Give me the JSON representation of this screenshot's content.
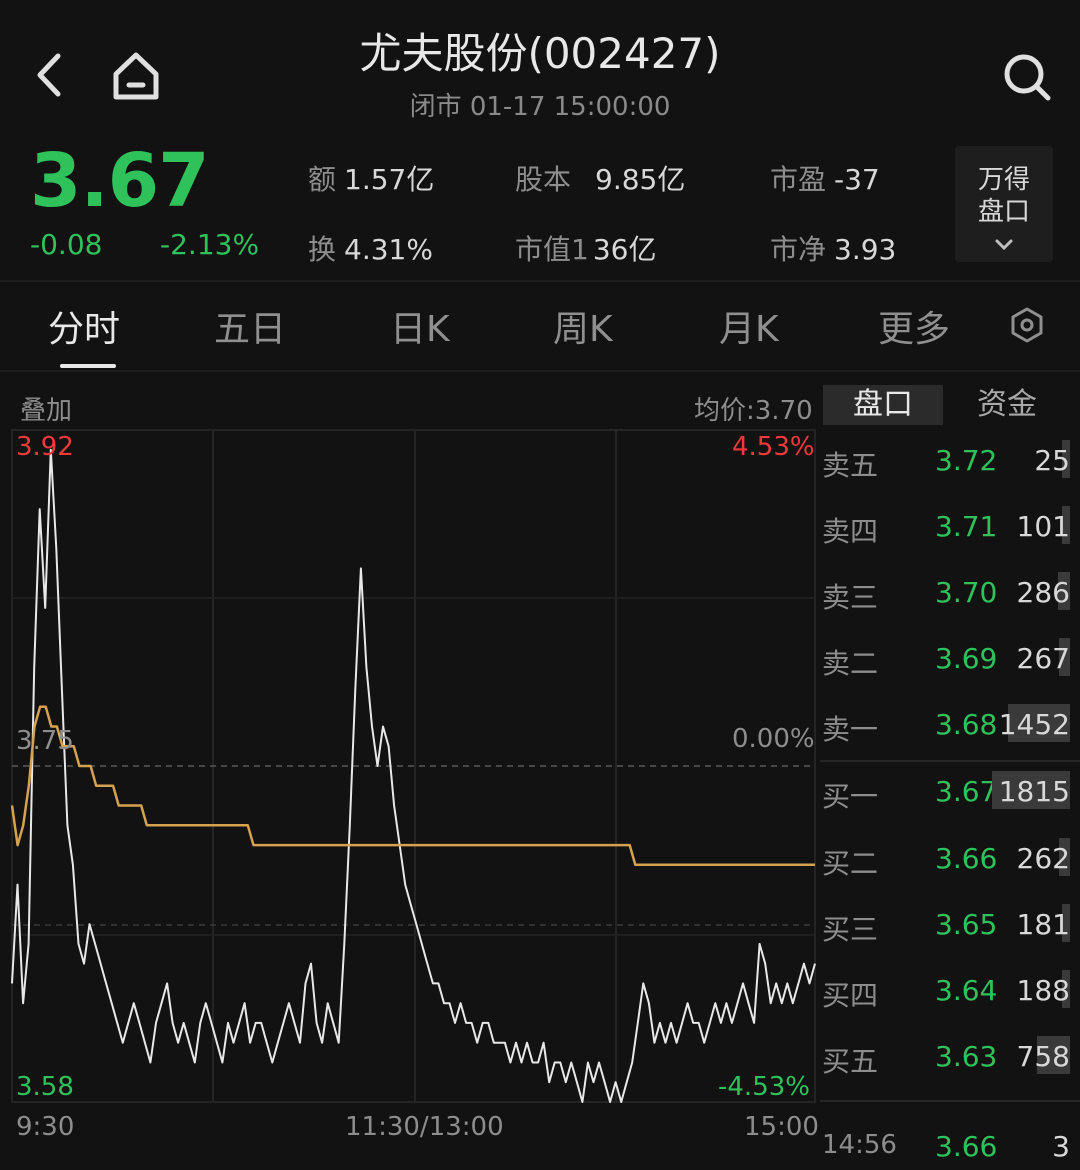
{
  "header": {
    "title": "尤夫股份(002427)",
    "subtitle": "闭市  01-17 15:00:00"
  },
  "quote": {
    "price": "3.67",
    "change": "-0.08",
    "change_pct": "-2.13%",
    "stats": [
      {
        "label": "额",
        "value": "1.57亿"
      },
      {
        "label": "股本",
        "value": "9.85亿"
      },
      {
        "label": "市盈",
        "value": "-37"
      },
      {
        "label": "换",
        "value": "4.31%"
      },
      {
        "label": "市值1",
        "value": "36亿"
      },
      {
        "label": "市净",
        "value": "3.93"
      }
    ],
    "wande_line1": "万得",
    "wande_line2": "盘口"
  },
  "tabs": [
    "分时",
    "五日",
    "日K",
    "周K",
    "月K",
    "更多"
  ],
  "chart": {
    "overlay_label": "叠加",
    "avg_price_label": "均价:3.70",
    "y_high": "3.92",
    "y_mid": "3.75",
    "y_low": "3.58",
    "pct_high": "4.53%",
    "pct_mid": "0.00%",
    "pct_low": "-4.53%",
    "time_start": "9:30",
    "time_mid": "11:30/13:00",
    "time_end": "15:00"
  },
  "chart_data": {
    "type": "line",
    "ylim": [
      3.58,
      3.92
    ],
    "reference": 3.75,
    "series": [
      {
        "values": [
          3.64,
          3.69,
          3.63,
          3.66,
          3.8,
          3.88,
          3.83,
          3.91,
          3.86,
          3.79,
          3.72,
          3.7,
          3.66,
          3.65,
          3.67,
          3.66,
          3.65,
          3.64,
          3.63,
          3.62,
          3.61,
          3.62,
          3.63,
          3.62,
          3.61,
          3.6,
          3.62,
          3.63,
          3.64,
          3.62,
          3.61,
          3.62,
          3.61,
          3.6,
          3.62,
          3.63,
          3.62,
          3.61,
          3.6,
          3.62,
          3.61,
          3.62,
          3.63,
          3.61,
          3.62,
          3.62,
          3.61,
          3.6,
          3.61,
          3.62,
          3.63,
          3.62,
          3.61,
          3.64,
          3.65,
          3.62,
          3.61,
          3.63,
          3.62,
          3.61,
          3.66,
          3.72,
          3.79,
          3.85,
          3.8,
          3.77,
          3.75,
          3.77,
          3.76,
          3.73,
          3.71,
          3.69,
          3.68,
          3.67,
          3.66,
          3.65,
          3.64,
          3.64,
          3.63,
          3.63,
          3.62,
          3.63,
          3.62,
          3.62,
          3.61,
          3.62,
          3.62,
          3.61,
          3.61,
          3.61,
          3.6,
          3.61,
          3.6,
          3.61,
          3.6,
          3.6,
          3.61,
          3.59,
          3.6,
          3.6,
          3.59,
          3.6,
          3.59,
          3.58,
          3.6,
          3.59,
          3.6,
          3.59,
          3.58,
          3.59,
          3.58,
          3.59,
          3.6,
          3.62,
          3.64,
          3.63,
          3.61,
          3.62,
          3.61,
          3.62,
          3.61,
          3.62,
          3.63,
          3.62,
          3.62,
          3.61,
          3.62,
          3.63,
          3.62,
          3.63,
          3.62,
          3.63,
          3.64,
          3.63,
          3.62,
          3.66,
          3.65,
          3.63,
          3.64,
          3.63,
          3.64,
          3.63,
          3.64,
          3.65,
          3.64,
          3.65
        ]
      },
      {
        "values": [
          3.73,
          3.71,
          3.72,
          3.74,
          3.77,
          3.78,
          3.78,
          3.77,
          3.77,
          3.76,
          3.76,
          3.76,
          3.75,
          3.75,
          3.75,
          3.74,
          3.74,
          3.74,
          3.74,
          3.73,
          3.73,
          3.73,
          3.73,
          3.73,
          3.72,
          3.72,
          3.72,
          3.72,
          3.72,
          3.72,
          3.72,
          3.72,
          3.72,
          3.72,
          3.72,
          3.72,
          3.72,
          3.72,
          3.72,
          3.72,
          3.72,
          3.72,
          3.72,
          3.71,
          3.71,
          3.71,
          3.71,
          3.71,
          3.71,
          3.71,
          3.71,
          3.71,
          3.71,
          3.71,
          3.71,
          3.71,
          3.71,
          3.71,
          3.71,
          3.71,
          3.71,
          3.71,
          3.71,
          3.71,
          3.71,
          3.71,
          3.71,
          3.71,
          3.71,
          3.71,
          3.71,
          3.71,
          3.71,
          3.71,
          3.71,
          3.71,
          3.71,
          3.71,
          3.71,
          3.71,
          3.71,
          3.71,
          3.71,
          3.71,
          3.71,
          3.71,
          3.71,
          3.71,
          3.71,
          3.71,
          3.71,
          3.71,
          3.71,
          3.71,
          3.71,
          3.71,
          3.71,
          3.71,
          3.71,
          3.71,
          3.71,
          3.71,
          3.71,
          3.71,
          3.71,
          3.71,
          3.71,
          3.71,
          3.71,
          3.71,
          3.71,
          3.7,
          3.7,
          3.7,
          3.7,
          3.7,
          3.7,
          3.7,
          3.7,
          3.7,
          3.7,
          3.7,
          3.7,
          3.7,
          3.7,
          3.7,
          3.7,
          3.7,
          3.7,
          3.7,
          3.7,
          3.7,
          3.7,
          3.7,
          3.7,
          3.7,
          3.7,
          3.7,
          3.7,
          3.7,
          3.7,
          3.7,
          3.7,
          3.7
        ]
      }
    ],
    "colors": [
      "#e8e8e8",
      "#d6a24f"
    ]
  },
  "panel": {
    "tab_active": "盘口",
    "tab_other": "资金",
    "orders": [
      {
        "label": "卖五",
        "price": "3.72",
        "volume": "25"
      },
      {
        "label": "卖四",
        "price": "3.71",
        "volume": "101"
      },
      {
        "label": "卖三",
        "price": "3.70",
        "volume": "286"
      },
      {
        "label": "卖二",
        "price": "3.69",
        "volume": "267"
      },
      {
        "label": "卖一",
        "price": "3.68",
        "volume": "1452"
      },
      {
        "label": "买一",
        "price": "3.67",
        "volume": "1815"
      },
      {
        "label": "买二",
        "price": "3.66",
        "volume": "262"
      },
      {
        "label": "买三",
        "price": "3.65",
        "volume": "181"
      },
      {
        "label": "买四",
        "price": "3.64",
        "volume": "188"
      },
      {
        "label": "买五",
        "price": "3.63",
        "volume": "758"
      }
    ],
    "trade": {
      "time": "14:56",
      "price": "3.66",
      "volume": "3"
    }
  },
  "icons": [
    "back-icon",
    "home-icon",
    "search-icon",
    "settings-icon",
    "chevron-down-icon"
  ]
}
